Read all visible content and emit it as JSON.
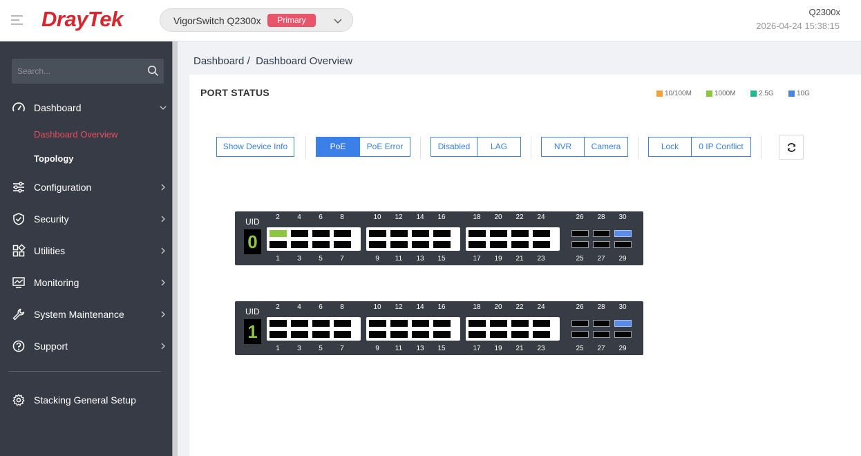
{
  "header": {
    "brand": "DrayTek",
    "device_name": "VigorSwitch Q2300x",
    "device_role": "Primary",
    "model": "Q2300x",
    "datetime": "2026-04-24 15:38:15"
  },
  "sidebar": {
    "search_placeholder": "Search...",
    "items": [
      {
        "label": "Dashboard",
        "icon": "gauge-icon"
      },
      {
        "label": "Configuration",
        "icon": "sliders-icon"
      },
      {
        "label": "Security",
        "icon": "shield-icon"
      },
      {
        "label": "Utilities",
        "icon": "grid-icon"
      },
      {
        "label": "Monitoring",
        "icon": "monitor-icon"
      },
      {
        "label": "System Maintenance",
        "icon": "wrench-icon"
      },
      {
        "label": "Support",
        "icon": "help-icon"
      }
    ],
    "sub_items": [
      "Dashboard Overview",
      "Topology"
    ],
    "footer_item": "Stacking General Setup"
  },
  "breadcrumb": {
    "root": "Dashboard",
    "separator": "/",
    "current": "Dashboard Overview"
  },
  "port_status": {
    "title": "PORT STATUS",
    "legend": [
      {
        "label": "10/100M",
        "color": "#f5a13a"
      },
      {
        "label": "1000M",
        "color": "#8ec63f"
      },
      {
        "label": "2.5G",
        "color": "#23b88f"
      },
      {
        "label": "10G",
        "color": "#4a83e6"
      }
    ],
    "buttons": {
      "show_device_info": "Show Device Info",
      "poe": "PoE",
      "poe_error": "PoE Error",
      "disabled": "Disabled",
      "lag": "LAG",
      "nvr": "NVR",
      "camera": "Camera",
      "lock": "Lock",
      "ip_conflict": "0 IP Conflict"
    },
    "active_filter": "PoE",
    "uid_label": "UID",
    "switches": [
      {
        "uid": "0",
        "port_1000m": [
          2
        ],
        "port_10g": [
          30
        ]
      },
      {
        "uid": "1",
        "port_1000m": [],
        "port_10g": [
          30
        ]
      }
    ]
  }
}
